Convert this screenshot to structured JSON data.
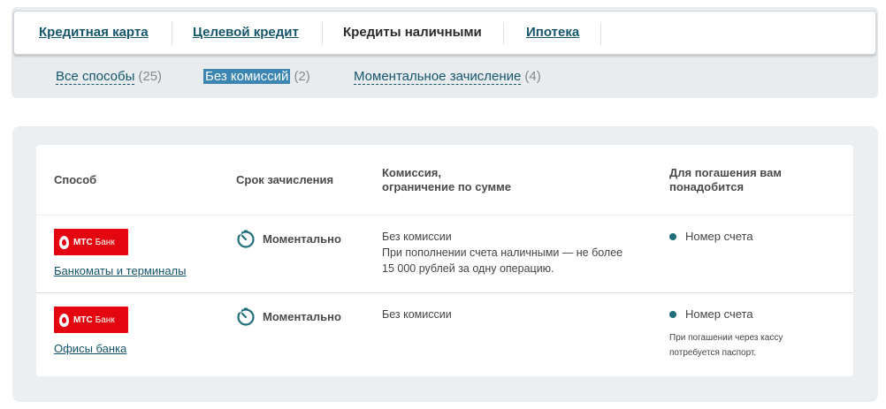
{
  "tabs": [
    {
      "label": "Кредитная карта",
      "active": false
    },
    {
      "label": "Целевой кредит",
      "active": false
    },
    {
      "label": "Кредиты наличными",
      "active": true
    },
    {
      "label": "Ипотека",
      "active": false
    }
  ],
  "filters": [
    {
      "label": "Все способы",
      "count": "(25)",
      "active": false
    },
    {
      "label": "Без комиссий",
      "count": "(2)",
      "active": true
    },
    {
      "label": "Моментальное зачисление",
      "count": "(4)",
      "active": false
    }
  ],
  "table": {
    "headers": {
      "method": "Способ",
      "speed": "Срок зачисления",
      "fee_line1": "Комиссия,",
      "fee_line2": "ограничение по сумме",
      "req_line1": "Для погашения вам",
      "req_line2": "понадобится"
    },
    "rows": [
      {
        "bank_logo_main": "МТС",
        "bank_logo_sub": "Банк",
        "method": "Банкоматы и терминалы",
        "speed": "Моментально",
        "fee_line1": "Без комиссии",
        "fee_line2": "При пополнении счета наличными — не более",
        "fee_line3": "15 000 рублей за одну операцию.",
        "requirement": "Номер счета",
        "note_line1": "",
        "note_line2": ""
      },
      {
        "bank_logo_main": "МТС",
        "bank_logo_sub": "Банк",
        "method": "Офисы банка",
        "speed": "Моментально",
        "fee_line1": "Без комиссии",
        "fee_line2": "",
        "fee_line3": "",
        "requirement": "Номер счета",
        "note_line1": "При погашении через кассу",
        "note_line2": "потребуется паспорт."
      }
    ]
  },
  "colors": {
    "link": "#15566b",
    "active_filter_bg": "#3b86b3",
    "brand_red": "#e30611",
    "dot": "#1f6e7a"
  },
  "icons": {
    "timer": "stopwatch-icon",
    "logo": "mts-egg-icon",
    "bullet": "bullet-dot-icon"
  }
}
